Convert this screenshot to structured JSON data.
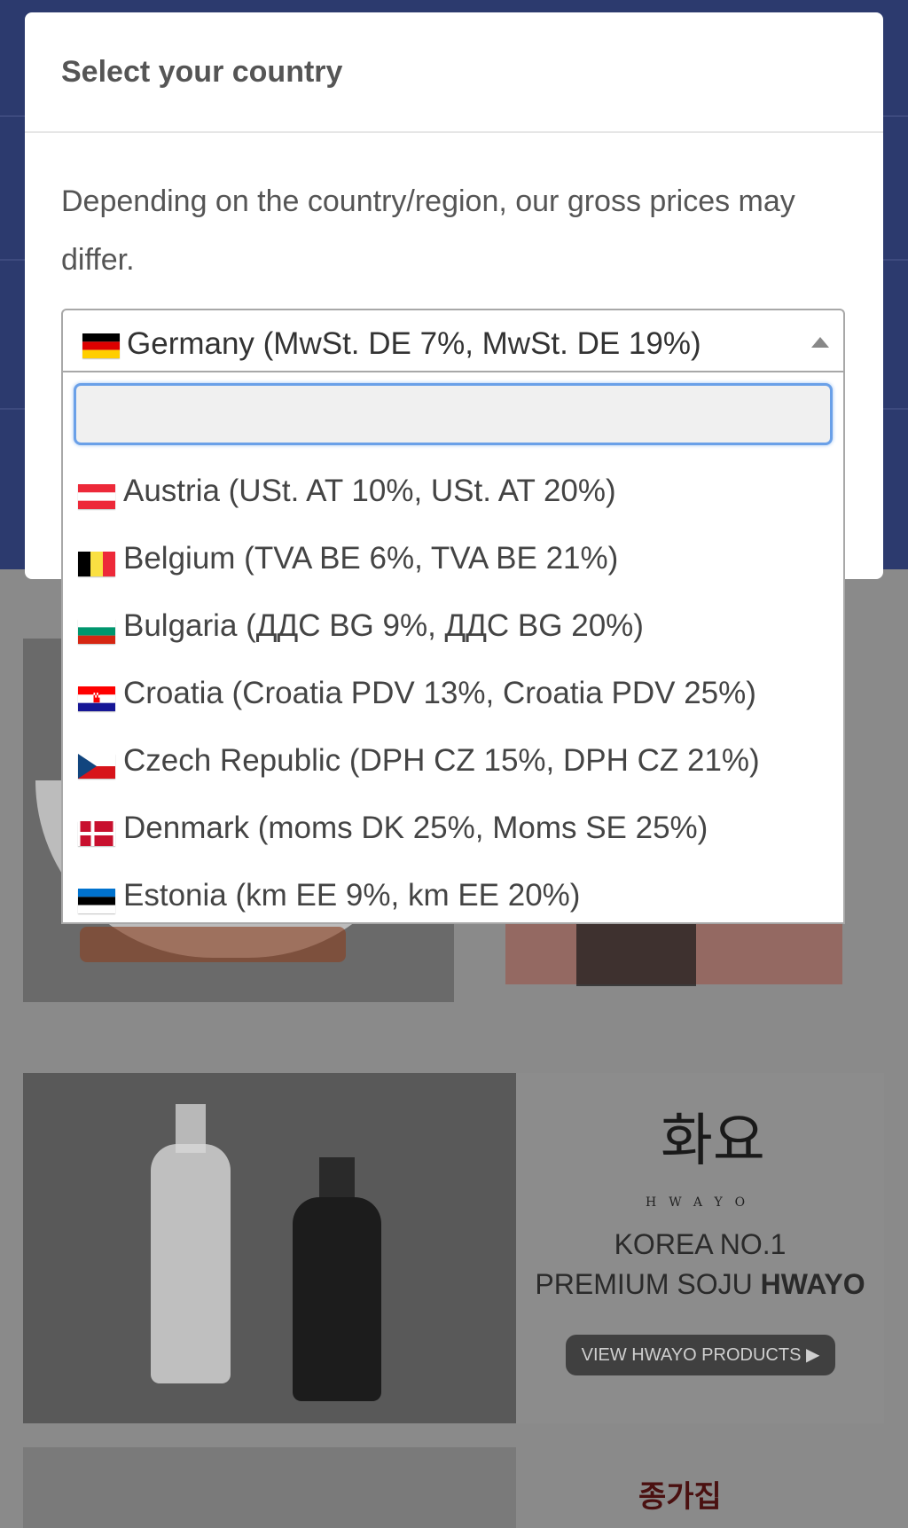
{
  "modal": {
    "title": "Select your country",
    "description": "Depending on the country/region, our gross prices may differ."
  },
  "select": {
    "selected": {
      "label": "Germany (MwSt. DE 7%, MwSt. DE 19%)",
      "flag": "germany-flag-icon"
    },
    "search_value": "",
    "options": [
      {
        "label": "Austria (USt. AT 10%, USt. AT 20%)",
        "flag": "austria-flag-icon"
      },
      {
        "label": "Belgium (TVA BE 6%, TVA BE 21%)",
        "flag": "belgium-flag-icon"
      },
      {
        "label": "Bulgaria (ДДС BG 9%, ДДС BG 20%)",
        "flag": "bulgaria-flag-icon"
      },
      {
        "label": "Croatia (Croatia PDV 13%, Croatia PDV 25%)",
        "flag": "croatia-flag-icon"
      },
      {
        "label": "Czech Republic (DPH CZ 15%, DPH CZ 21%)",
        "flag": "czech-flag-icon"
      },
      {
        "label": "Denmark (moms DK 25%, Moms SE 25%)",
        "flag": "denmark-flag-icon"
      },
      {
        "label": "Estonia (km EE 9%, km EE 20%)",
        "flag": "estonia-flag-icon"
      }
    ]
  },
  "background": {
    "hwayo_brand": "HWAYO",
    "hwayo_line1": "KOREA NO.1",
    "hwayo_line2_plain": "PREMIUM SOJU ",
    "hwayo_line2_bold": "HWAYO",
    "hwayo_button": "VIEW HWAYO PRODUCTS ▶"
  },
  "colors": {
    "header_navy": "#2c3a6e",
    "focus_blue": "#6aa0e8",
    "overlay_dim": "#8a8a8a"
  }
}
